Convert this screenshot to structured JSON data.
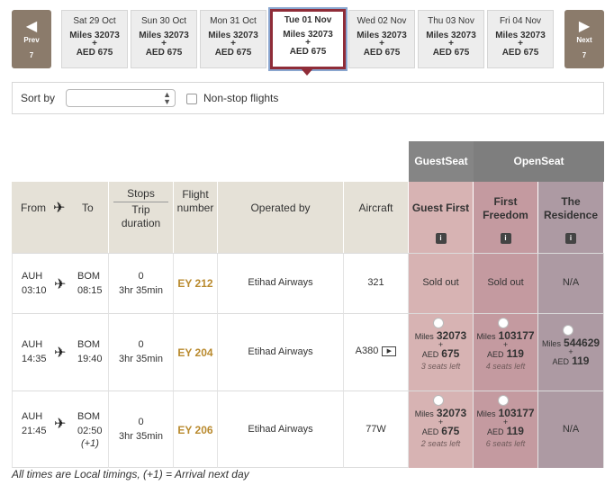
{
  "date_nav": {
    "prev": {
      "label": "Prev",
      "count": "7"
    },
    "next": {
      "label": "Next",
      "count": "7"
    },
    "dates": [
      {
        "day": "Sat 29 Oct",
        "miles": "Miles 32073",
        "plus": "+",
        "aed": "AED 675"
      },
      {
        "day": "Sun 30 Oct",
        "miles": "Miles 32073",
        "plus": "+",
        "aed": "AED 675"
      },
      {
        "day": "Mon 31 Oct",
        "miles": "Miles 32073",
        "plus": "+",
        "aed": "AED 675"
      },
      {
        "day": "Tue 01 Nov",
        "miles": "Miles 32073",
        "plus": "+",
        "aed": "AED 675"
      },
      {
        "day": "Wed 02 Nov",
        "miles": "Miles 32073",
        "plus": "+",
        "aed": "AED 675"
      },
      {
        "day": "Thu 03 Nov",
        "miles": "Miles 32073",
        "plus": "+",
        "aed": "AED 675"
      },
      {
        "day": "Fri 04 Nov",
        "miles": "Miles 32073",
        "plus": "+",
        "aed": "AED 675"
      }
    ],
    "selected_index": 3
  },
  "sort": {
    "label": "Sort by",
    "selected": "",
    "nonstop_label": "Non-stop flights"
  },
  "table": {
    "group_headers": {
      "guest": "GuestSeat",
      "open": "OpenSeat"
    },
    "headers": {
      "from": "From",
      "to": "To",
      "stops": "Stops",
      "trip_duration_1": "Trip",
      "trip_duration_2": "duration",
      "flight_1": "Flight",
      "flight_2": "number",
      "operated_by": "Operated by",
      "aircraft": "Aircraft",
      "guest_first": "Guest First",
      "first_freedom_1": "First",
      "first_freedom_2": "Freedom",
      "residence_1": "The",
      "residence_2": "Residence",
      "info": "i"
    },
    "rows": [
      {
        "from": "AUH",
        "dep": "03:10",
        "to": "BOM",
        "arr": "08:15",
        "arr_note": "",
        "stops": "0",
        "duration": "3hr 35min",
        "flight": "EY 212",
        "operator": "Etihad Airways",
        "aircraft": "321",
        "guest_first": {
          "status": "Sold out"
        },
        "first_freedom": {
          "status": "Sold out"
        },
        "residence": {
          "status": "N/A"
        }
      },
      {
        "from": "AUH",
        "dep": "14:35",
        "to": "BOM",
        "arr": "19:40",
        "arr_note": "",
        "stops": "0",
        "duration": "3hr 35min",
        "flight": "EY 204",
        "operator": "Etihad Airways",
        "aircraft": "A380",
        "guest_first": {
          "miles_label": "Miles",
          "miles": "32073",
          "plus": "+",
          "aed_label": "AED",
          "aed": "675",
          "seats": "3 seats left"
        },
        "first_freedom": {
          "miles_label": "Miles",
          "miles": "103177",
          "plus": "+",
          "aed_label": "AED",
          "aed": "119",
          "seats": "4 seats left"
        },
        "residence": {
          "miles_label": "Miles",
          "miles": "544629",
          "plus": "+",
          "aed_label": "AED",
          "aed": "119"
        }
      },
      {
        "from": "AUH",
        "dep": "21:45",
        "to": "BOM",
        "arr": "02:50",
        "arr_note": "(+1)",
        "stops": "0",
        "duration": "3hr 35min",
        "flight": "EY 206",
        "operator": "Etihad Airways",
        "aircraft": "77W",
        "guest_first": {
          "miles_label": "Miles",
          "miles": "32073",
          "plus": "+",
          "aed_label": "AED",
          "aed": "675",
          "seats": "2 seats left"
        },
        "first_freedom": {
          "miles_label": "Miles",
          "miles": "103177",
          "plus": "+",
          "aed_label": "AED",
          "aed": "119",
          "seats": "6 seats left"
        },
        "residence": {
          "status": "N/A"
        }
      }
    ]
  },
  "footnote": "All times are Local timings, (+1) = Arrival next day",
  "colors": {
    "accent": "#8f2c38",
    "nav": "#8b7b6b",
    "flight_no": "#b98a2e",
    "guest_first": "#d7b3b3",
    "first_freedom": "#c49aa0",
    "residence": "#ad9aa3"
  },
  "icons": {
    "prev": "triangle-left-icon",
    "next": "triangle-right-icon",
    "plane": "airplane-icon",
    "info": "info-icon",
    "play": "play-icon"
  }
}
